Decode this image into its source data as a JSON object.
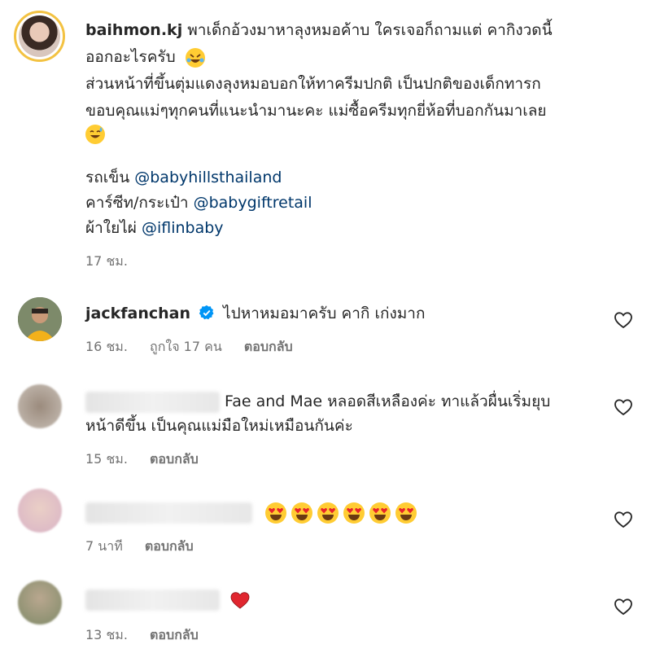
{
  "caption": {
    "username": "baihmon.kj",
    "line1": "พาเด็กอ้วงมาหาลุงหมอค้าบ ใครเจอก็ถามแต่ คากิงวดนี้",
    "line2": "ออกอะไรครับ",
    "line3": "ส่วนหน้าที่ขึ้นตุ่มแดงลุงหมอบอกให้ทาครีมปกติ เป็นปกติของเด็กทารก",
    "line4": "ขอบคุณแม่ๆทุกคนที่แนะนำมานะคะ แม่ซื้อครีมทุกยี่ห้อที่บอกกันมาเลย",
    "stroller_label": "รถเข็น",
    "stroller_mention": "@babyhillsthailand",
    "carseat_label": "คาร์ซีท/กระเป๋า",
    "carseat_mention": "@babygiftretail",
    "cloth_label": "ผ้าใยไผ่",
    "cloth_mention": "@iflinbaby",
    "time": "17 ชม."
  },
  "comments": [
    {
      "username": "jackfanchan",
      "verified": true,
      "text": "ไปหาหมอมาครับ คากิ เก่งมาก",
      "time": "16 ชม.",
      "likes": "ถูกใจ 17 คน",
      "reply": "ตอบกลับ"
    },
    {
      "username_blurred": true,
      "text1": "Fae and Mae หลอดสีเหลืองค่ะ ทาแล้วผื่นเริ่มยุบ",
      "text2": "หน้าดีขึ้น เป็นคุณแม่มือใหม่เหมือนกันค่ะ",
      "time": "15 ชม.",
      "reply": "ตอบกลับ"
    },
    {
      "username_blurred": true,
      "text": "😍😍😍😍😍😍",
      "emoji_count": 6,
      "time": "7 นาที",
      "reply": "ตอบกลับ"
    },
    {
      "username_blurred": true,
      "text": "❤️",
      "time": "13 ชม.",
      "reply": "ตอบกลับ"
    }
  ],
  "icons": {
    "like": "heart-outline-icon",
    "verified": "verified-badge-icon"
  },
  "colors": {
    "text": "#262626",
    "secondary": "#737373",
    "mention": "#00376b",
    "verified": "#0095f6",
    "story_ring": "#f3c242",
    "heart_red": "#e0262f"
  }
}
